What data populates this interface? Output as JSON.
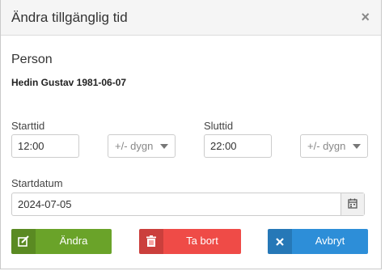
{
  "modal": {
    "title": "Ändra tillgänglig tid",
    "close_glyph": "×"
  },
  "person": {
    "label": "Person",
    "name": "Hedin Gustav 1981-06-07"
  },
  "start": {
    "label": "Starttid",
    "value": "12:00",
    "offset_select": "+/- dygn"
  },
  "end": {
    "label": "Sluttid",
    "value": "22:00",
    "offset_select": "+/- dygn"
  },
  "date": {
    "label": "Startdatum",
    "value": "2024-07-05",
    "icon": "calendar-icon"
  },
  "buttons": {
    "edit": {
      "label": "Ändra",
      "icon": "edit-icon",
      "color": "#6aa329"
    },
    "delete": {
      "label": "Ta bort",
      "icon": "trash-icon",
      "color": "#ef4b47"
    },
    "cancel": {
      "label": "Avbryt",
      "icon": "close-icon",
      "color": "#2d8ed8"
    }
  }
}
